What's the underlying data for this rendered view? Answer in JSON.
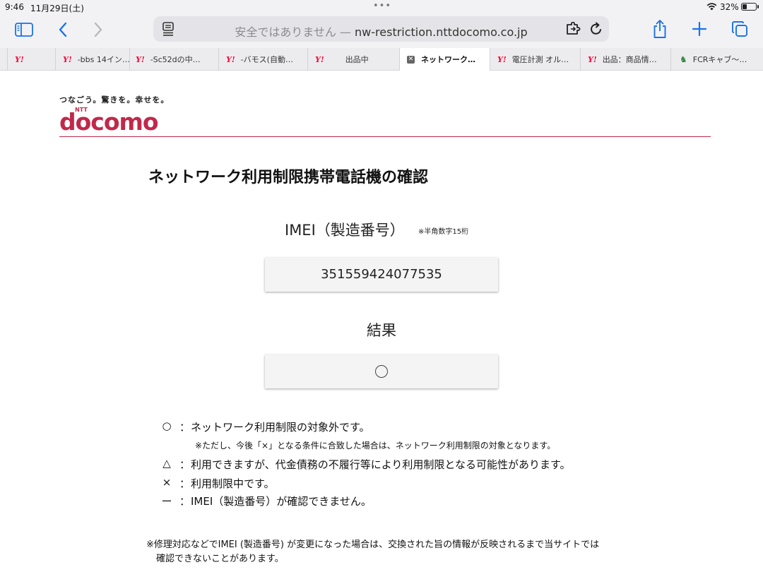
{
  "status": {
    "time": "9:46",
    "date": "11月29日(土)",
    "dots": "•••",
    "battery": "32%"
  },
  "toolbar": {
    "address_warning": "安全ではありません —",
    "address_url": "nw-restriction.nttdocomo.co.jp"
  },
  "tabs": [
    {
      "favicon": "Y!",
      "label": ""
    },
    {
      "favicon": "Y!",
      "label": "-bbs 14イン…"
    },
    {
      "favicon": "Y!",
      "label": "-Sc52dの中…"
    },
    {
      "favicon": "Y!",
      "label": "-バモス(自動…"
    },
    {
      "favicon": "Y!",
      "label": "出品中"
    },
    {
      "favicon": "x-square-icon",
      "label": "ネットワーク…"
    },
    {
      "favicon": "Y!",
      "label": "電圧計測 オル…"
    },
    {
      "favicon": "Y!",
      "label": "出品：商品情…"
    },
    {
      "favicon": "fcr-icon",
      "label": "FCRキャブ〜…"
    }
  ],
  "brand": {
    "tagline": "つなごう。驚きを。幸せを。",
    "logo_ntt": "NTT",
    "logo_name": "docomo",
    "color": "#c0294a"
  },
  "page": {
    "title": "ネットワーク利用制限携帯電話機の確認",
    "imei_label": "IMEI（製造番号）",
    "imei_note": "※半角数字15桁",
    "imei_value": "351559424077535",
    "result_label": "結果",
    "result_value": "○"
  },
  "legend": [
    {
      "symbol": "○",
      "colon": "：",
      "text": "ネットワーク利用制限の対象外です。"
    },
    {
      "note": "※ただし、今後「×」となる条件に合致した場合は、ネットワーク利用制限の対象となります。"
    },
    {
      "symbol": "△",
      "colon": "：",
      "text": "利用できますが、代金債務の不履行等により利用制限となる可能性があります。"
    },
    {
      "symbol": "×",
      "colon": "：",
      "text": "利用制限中です。"
    },
    {
      "symbol": "ー",
      "colon": "：",
      "text": "IMEI（製造番号）が確認できません。"
    }
  ],
  "footnote": {
    "line1": "※修理対応などでIMEI (製造番号) が変更になった場合は、交換された旨の情報が反映されるまで当サイトでは",
    "line2": "確認できないことがあります。"
  }
}
